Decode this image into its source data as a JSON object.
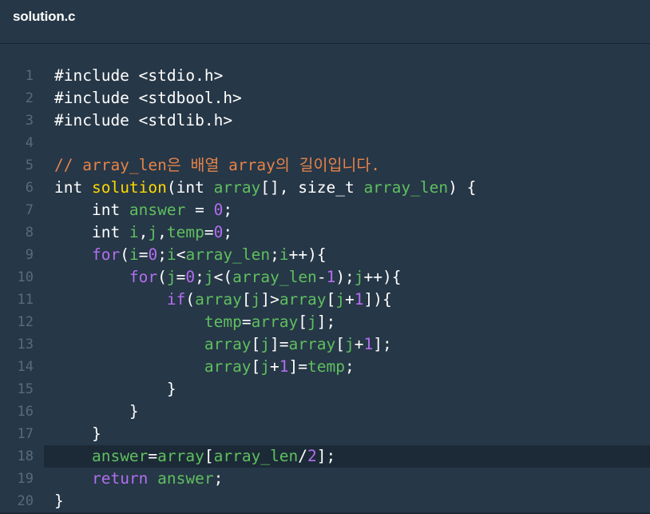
{
  "tab": {
    "filename": "solution.c"
  },
  "colors": {
    "background": "#263747",
    "comment": "#e58349",
    "function": "#ffd700",
    "keyword": "#b36ef0",
    "variable": "#5fbf5f",
    "number": "#b36ef0",
    "default": "#ffffff",
    "line_number": "#5a6a7a",
    "active_line": "#1c2a37"
  },
  "active_line": 18,
  "lines": [
    {
      "n": "1",
      "tokens": [
        [
          "def",
          "#include <stdio.h>"
        ]
      ]
    },
    {
      "n": "2",
      "tokens": [
        [
          "def",
          "#include <stdbool.h>"
        ]
      ]
    },
    {
      "n": "3",
      "tokens": [
        [
          "def",
          "#include <stdlib.h>"
        ]
      ]
    },
    {
      "n": "4",
      "tokens": []
    },
    {
      "n": "5",
      "tokens": [
        [
          "cm",
          "// array_len은 배열 array의 길이입니다."
        ]
      ]
    },
    {
      "n": "6",
      "tokens": [
        [
          "def",
          "int "
        ],
        [
          "fn",
          "solution"
        ],
        [
          "def",
          "(int "
        ],
        [
          "var",
          "array"
        ],
        [
          "def",
          "[], size_t "
        ],
        [
          "var",
          "array_len"
        ],
        [
          "def",
          ") {"
        ]
      ]
    },
    {
      "n": "7",
      "tokens": [
        [
          "def",
          "    int "
        ],
        [
          "var",
          "answer"
        ],
        [
          "def",
          " = "
        ],
        [
          "num",
          "0"
        ],
        [
          "def",
          ";"
        ]
      ]
    },
    {
      "n": "8",
      "tokens": [
        [
          "def",
          "    int "
        ],
        [
          "var",
          "i"
        ],
        [
          "def",
          ","
        ],
        [
          "var",
          "j"
        ],
        [
          "def",
          ","
        ],
        [
          "var",
          "temp"
        ],
        [
          "def",
          "="
        ],
        [
          "num",
          "0"
        ],
        [
          "def",
          ";"
        ]
      ]
    },
    {
      "n": "9",
      "tokens": [
        [
          "def",
          "    "
        ],
        [
          "kw",
          "for"
        ],
        [
          "def",
          "("
        ],
        [
          "var",
          "i"
        ],
        [
          "def",
          "="
        ],
        [
          "num",
          "0"
        ],
        [
          "def",
          ";"
        ],
        [
          "var",
          "i"
        ],
        [
          "def",
          "<"
        ],
        [
          "var",
          "array_len"
        ],
        [
          "def",
          ";"
        ],
        [
          "var",
          "i"
        ],
        [
          "def",
          "++){"
        ]
      ]
    },
    {
      "n": "10",
      "tokens": [
        [
          "def",
          "        "
        ],
        [
          "kw",
          "for"
        ],
        [
          "def",
          "("
        ],
        [
          "var",
          "j"
        ],
        [
          "def",
          "="
        ],
        [
          "num",
          "0"
        ],
        [
          "def",
          ";"
        ],
        [
          "var",
          "j"
        ],
        [
          "def",
          "<("
        ],
        [
          "var",
          "array_len"
        ],
        [
          "def",
          "-"
        ],
        [
          "num",
          "1"
        ],
        [
          "def",
          ");"
        ],
        [
          "var",
          "j"
        ],
        [
          "def",
          "++){"
        ]
      ]
    },
    {
      "n": "11",
      "tokens": [
        [
          "def",
          "            "
        ],
        [
          "kw",
          "if"
        ],
        [
          "def",
          "("
        ],
        [
          "var",
          "array"
        ],
        [
          "def",
          "["
        ],
        [
          "var",
          "j"
        ],
        [
          "def",
          "]>"
        ],
        [
          "var",
          "array"
        ],
        [
          "def",
          "["
        ],
        [
          "var",
          "j"
        ],
        [
          "def",
          "+"
        ],
        [
          "num",
          "1"
        ],
        [
          "def",
          "]){"
        ]
      ]
    },
    {
      "n": "12",
      "tokens": [
        [
          "def",
          "                "
        ],
        [
          "var",
          "temp"
        ],
        [
          "def",
          "="
        ],
        [
          "var",
          "array"
        ],
        [
          "def",
          "["
        ],
        [
          "var",
          "j"
        ],
        [
          "def",
          "];"
        ]
      ]
    },
    {
      "n": "13",
      "tokens": [
        [
          "def",
          "                "
        ],
        [
          "var",
          "array"
        ],
        [
          "def",
          "["
        ],
        [
          "var",
          "j"
        ],
        [
          "def",
          "]="
        ],
        [
          "var",
          "array"
        ],
        [
          "def",
          "["
        ],
        [
          "var",
          "j"
        ],
        [
          "def",
          "+"
        ],
        [
          "num",
          "1"
        ],
        [
          "def",
          "];"
        ]
      ]
    },
    {
      "n": "14",
      "tokens": [
        [
          "def",
          "                "
        ],
        [
          "var",
          "array"
        ],
        [
          "def",
          "["
        ],
        [
          "var",
          "j"
        ],
        [
          "def",
          "+"
        ],
        [
          "num",
          "1"
        ],
        [
          "def",
          "]="
        ],
        [
          "var",
          "temp"
        ],
        [
          "def",
          ";"
        ]
      ]
    },
    {
      "n": "15",
      "tokens": [
        [
          "def",
          "            }"
        ]
      ]
    },
    {
      "n": "16",
      "tokens": [
        [
          "def",
          "        }"
        ]
      ]
    },
    {
      "n": "17",
      "tokens": [
        [
          "def",
          "    }"
        ]
      ]
    },
    {
      "n": "18",
      "tokens": [
        [
          "def",
          "    "
        ],
        [
          "var",
          "answer"
        ],
        [
          "def",
          "="
        ],
        [
          "var",
          "array"
        ],
        [
          "def",
          "["
        ],
        [
          "var",
          "array_len"
        ],
        [
          "def",
          "/"
        ],
        [
          "num",
          "2"
        ],
        [
          "def",
          "];"
        ]
      ]
    },
    {
      "n": "19",
      "tokens": [
        [
          "def",
          "    "
        ],
        [
          "kw",
          "return"
        ],
        [
          "def",
          " "
        ],
        [
          "var",
          "answer"
        ],
        [
          "def",
          ";"
        ]
      ]
    },
    {
      "n": "20",
      "tokens": [
        [
          "def",
          "}"
        ]
      ]
    }
  ]
}
